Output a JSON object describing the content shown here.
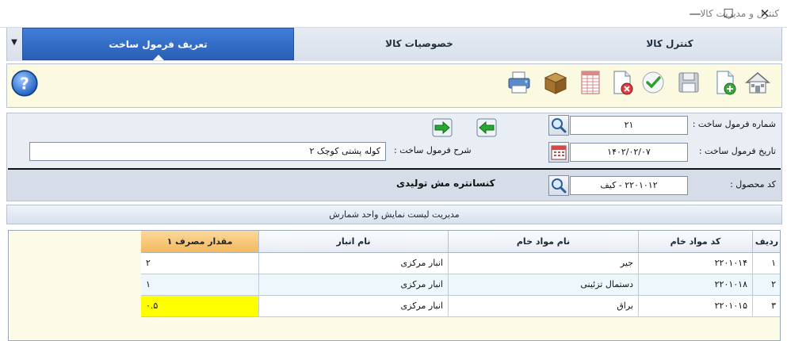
{
  "window": {
    "title": "کنترل و مدیریت کالا",
    "min": "—",
    "max": "☐",
    "close": "✕"
  },
  "tabs": [
    {
      "label": "کنترل کالا"
    },
    {
      "label": "خصوصیات کالا"
    },
    {
      "label": "تعریف فرمول ساخت"
    }
  ],
  "toolbar": {
    "icons": [
      "home-icon",
      "new-document-icon",
      "save-icon",
      "confirm-icon",
      "delete-document-icon",
      "table-icon",
      "box-icon",
      "print-icon",
      "help-icon"
    ],
    "help": "?"
  },
  "form": {
    "formula_number_label": "شماره فرمول ساخت :",
    "formula_number_value": "۲۱",
    "formula_date_label": "تاریخ فرمول ساخت :",
    "formula_date_value": "۱۴۰۲/۰۲/۰۷",
    "description_label": "شرح فرمول ساخت :",
    "description_value": "کوله پشتی کوچک ۲",
    "product_code_label": "کد محصول :",
    "product_code_value": "۲۲۰۱۰۱۲ - کیف",
    "product_name": "کنسانتره مش تولیدی"
  },
  "list_bar": {
    "label": "مدیریت لیست نمایش واحد شمارش"
  },
  "grid": {
    "headers": {
      "row": "ردیف",
      "code": "کد مواد خام",
      "name": "نام مواد خام",
      "warehouse": "نام انبار",
      "qty": "مقدار مصرف ۱"
    },
    "rows": [
      {
        "row": "۱",
        "code": "۲۲۰۱۰۱۴",
        "name": "جیر",
        "warehouse": "انبار مرکزی",
        "qty": "۲"
      },
      {
        "row": "۲",
        "code": "۲۲۰۱۰۱۸",
        "name": "دستمال تزئینی",
        "warehouse": "انبار مرکزی",
        "qty": "۱"
      },
      {
        "row": "۳",
        "code": "۲۲۰۱۰۱۵",
        "name": "براق",
        "warehouse": "انبار مرکزی",
        "qty": "۰.۵"
      }
    ]
  },
  "colors": {
    "active_tab": "#2f6cc4",
    "toolbar_bg": "#fcf9e1",
    "qty_header": "#f5c06c",
    "selected_cell": "#ffff00",
    "alt_row": "#eef7fb"
  }
}
